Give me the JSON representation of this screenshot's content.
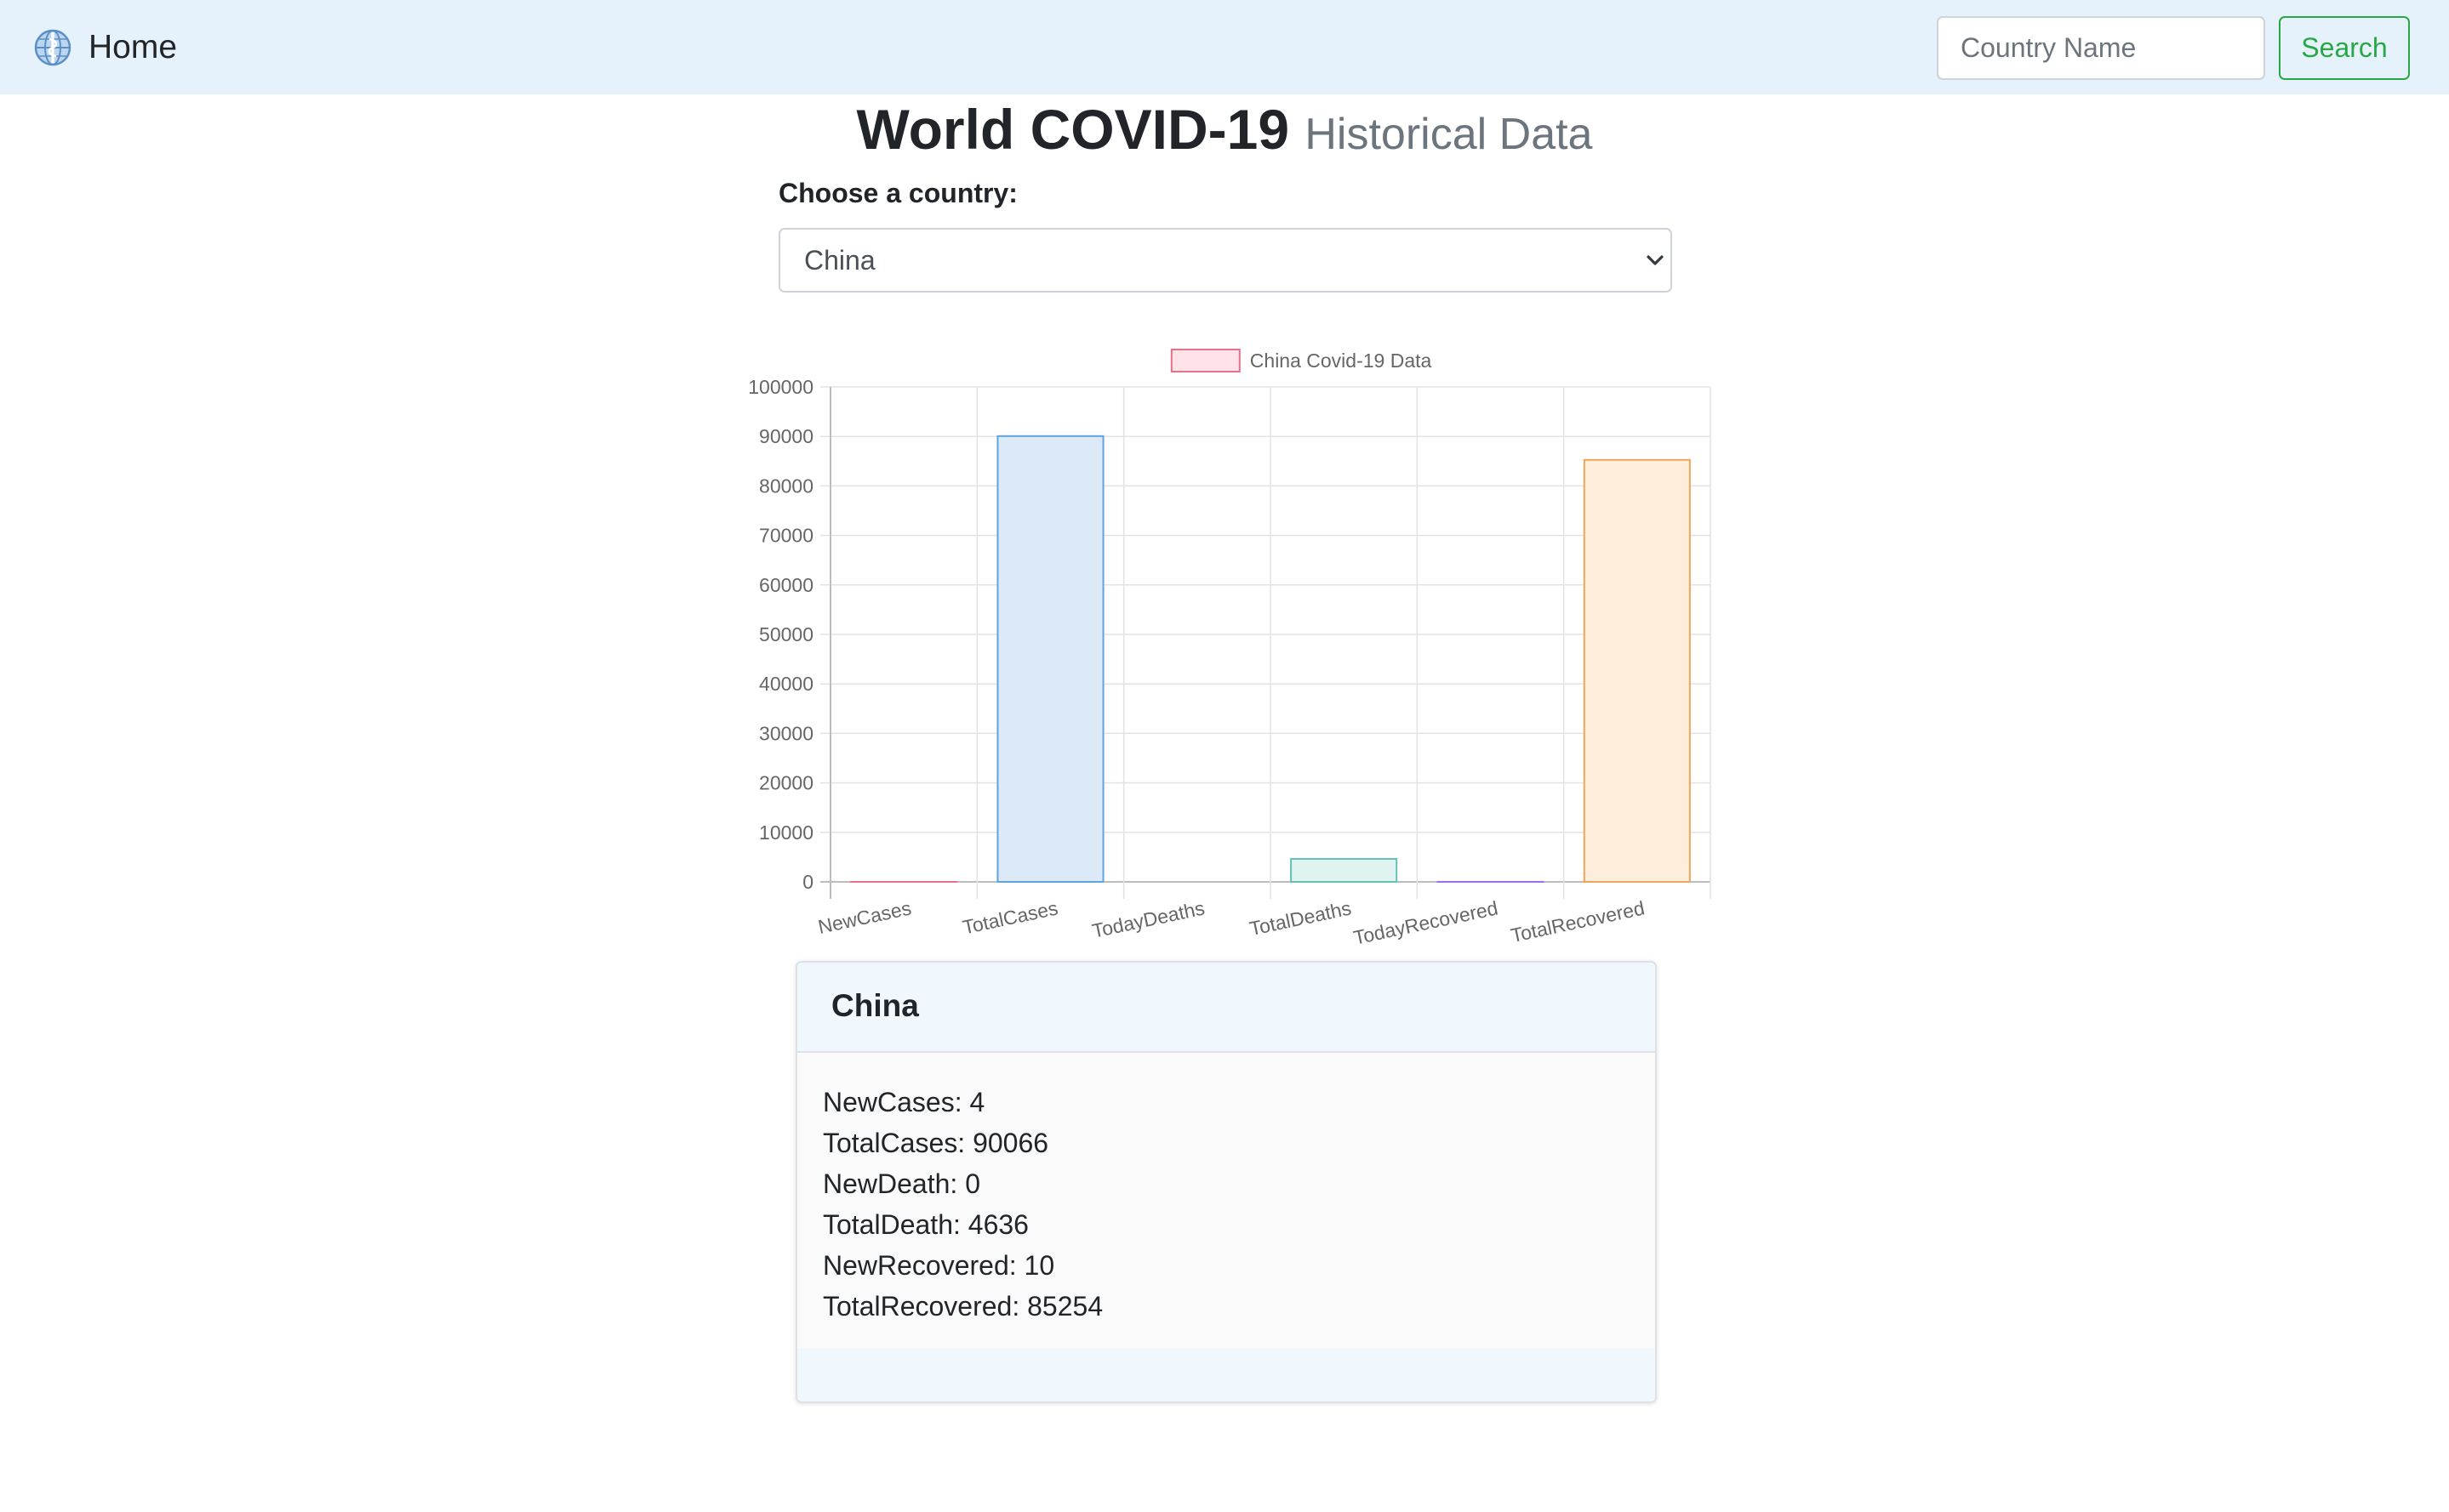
{
  "navbar": {
    "brand_label": "Home",
    "brand_icon": "who-globe-icon",
    "search_placeholder": "Country Name",
    "search_button_label": "Search",
    "bg_color": "#e6f2fb",
    "search_button_color": "#28a745"
  },
  "header": {
    "title": "World COVID-19",
    "subtitle": "Historical Data"
  },
  "country_picker": {
    "label": "Choose a country:",
    "selected": "China"
  },
  "chart_data": {
    "type": "bar",
    "categories": [
      "NewCases",
      "TotalCases",
      "TodayDeaths",
      "TotalDeaths",
      "TodayRecovered",
      "TotalRecovered"
    ],
    "series": [
      {
        "name": "China Covid-19 Data",
        "values": [
          4,
          90066,
          0,
          4636,
          10,
          85254
        ]
      }
    ],
    "ylim": [
      0,
      100000
    ],
    "yticks": [
      0,
      10000,
      20000,
      30000,
      40000,
      50000,
      60000,
      70000,
      80000,
      90000,
      100000
    ],
    "grid": true,
    "legend": "top",
    "legend_fill": "#fde3e8",
    "legend_stroke": "#e8708a",
    "bar_fills": [
      "#fde3e8",
      "#dceaf8",
      "#fdf3dc",
      "#dff3f0",
      "#ece3fb",
      "#fdeddb"
    ],
    "bar_strokes": [
      "#e8708a",
      "#5ea4e0",
      "#f2c55a",
      "#63c2b4",
      "#9b6fe8",
      "#f2a55a"
    ]
  },
  "card": {
    "title": "China",
    "stats": [
      "NewCases: 4",
      "TotalCases: 90066",
      "NewDeath: 0",
      "TotalDeath: 4636",
      "NewRecovered: 10",
      "TotalRecovered: 85254"
    ]
  }
}
